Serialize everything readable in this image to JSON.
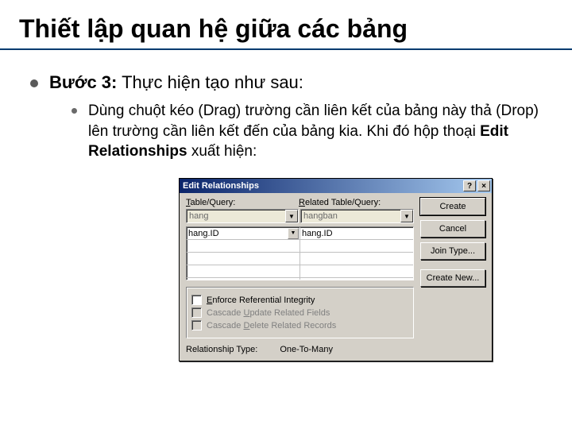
{
  "slide": {
    "title": "Thiết lập quan hệ giữa các bảng",
    "step_label": "Bước 3:",
    "step_text": " Thực hiện tạo như sau:",
    "sub_text_1": "Dùng chuột kéo (Drag) trường cần liên kết của bảng này thả (Drop) lên trường cần liên kết đến của bảng kia. Khi đó hộp thoại ",
    "sub_bold": "Edit Relationships",
    "sub_text_2": " xuất hiện:"
  },
  "dialog": {
    "title": "Edit Relationships",
    "help_btn": "?",
    "close_btn": "×",
    "table_query_label": "Table/Query:",
    "related_label": "Related Table/Query:",
    "left_table": "hang",
    "right_table": "hangban",
    "grid_left": "hang.ID",
    "grid_right": "hang.ID",
    "enforce": "Enforce Referential Integrity",
    "cascade_update": "Cascade Update Related Fields",
    "cascade_delete": "Cascade Delete Related Records",
    "rel_type_label": "Relationship Type:",
    "rel_type_value": "One-To-Many",
    "buttons": {
      "create": "Create",
      "cancel": "Cancel",
      "join": "Join Type...",
      "create_new": "Create New..."
    }
  }
}
